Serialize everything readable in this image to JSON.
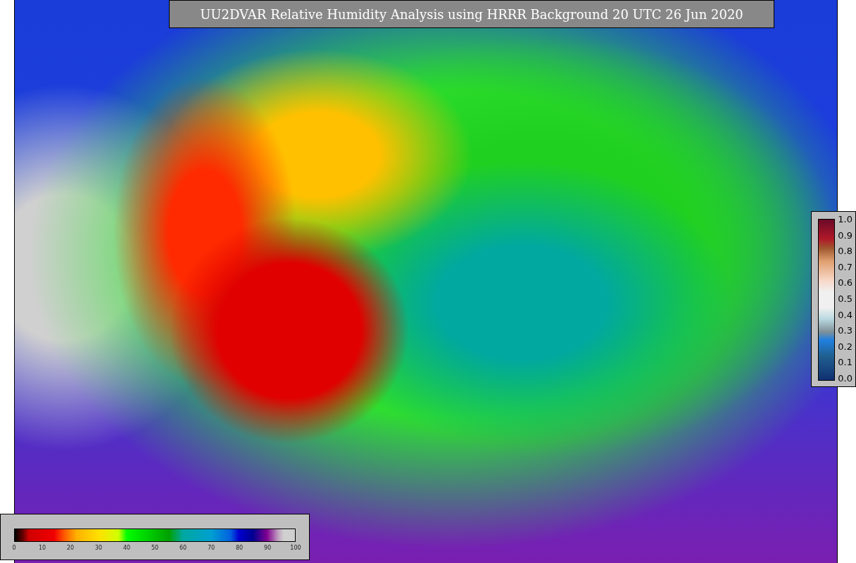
{
  "title": "UU2DVAR Relative Humidity Analysis using HRRR Background 20 UTC 26 Jun 2020",
  "humidity_colorbar": {
    "ticks": [
      "0",
      "10",
      "20",
      "30",
      "40",
      "50",
      "60",
      "70",
      "80",
      "90",
      "100"
    ]
  },
  "station_legend": {
    "ticks": [
      "1.0",
      "0.9",
      "0.8",
      "0.7",
      "0.6",
      "0.5",
      "0.4",
      "0.3",
      "0.2",
      "0.1",
      "0.0"
    ]
  }
}
